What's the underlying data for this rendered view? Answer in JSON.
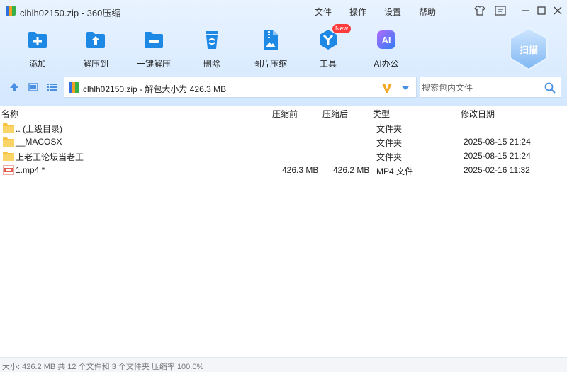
{
  "window": {
    "title": "clhlh02150.zip - 360压缩",
    "menus": [
      "文件",
      "操作",
      "设置",
      "帮助"
    ]
  },
  "toolbar": {
    "items": [
      {
        "label": "添加",
        "icon": "add-icon"
      },
      {
        "label": "解压到",
        "icon": "extract-to-icon"
      },
      {
        "label": "一键解压",
        "icon": "one-click-extract-icon"
      },
      {
        "label": "删除",
        "icon": "delete-icon"
      },
      {
        "label": "图片压缩",
        "icon": "image-compress-icon"
      },
      {
        "label": "工具",
        "icon": "tools-icon",
        "badge": "New"
      },
      {
        "label": "AI办公",
        "icon": "ai-office-icon",
        "icon_text": "AI"
      }
    ],
    "scan_label": "扫描"
  },
  "address": {
    "text": "clhlh02150.zip - 解包大小为 426.3 MB"
  },
  "search": {
    "placeholder": "搜索包内文件"
  },
  "columns": {
    "name": "名称",
    "compressed_before": "压缩前",
    "compressed_after": "压缩后",
    "type": "类型",
    "modified": "修改日期"
  },
  "files": [
    {
      "name": ".. (上级目录)",
      "before": "",
      "after": "",
      "type": "文件夹",
      "modified": "",
      "icon": "folder-icon"
    },
    {
      "name": "__MACOSX",
      "before": "",
      "after": "",
      "type": "文件夹",
      "modified": "2025-08-15 21:24",
      "icon": "folder-icon"
    },
    {
      "name": "上老王论坛当老王",
      "before": "",
      "after": "",
      "type": "文件夹",
      "modified": "2025-08-15 21:24",
      "icon": "folder-icon"
    },
    {
      "name": "1.mp4 *",
      "before": "426.3 MB",
      "after": "426.2 MB",
      "type": "MP4 文件",
      "modified": "2025-02-16 11:32",
      "icon": "mp4-file-icon"
    }
  ],
  "status": {
    "text": "大小: 426.2 MB 共 12 个文件和 3 个文件夹 压缩率 100.0%"
  },
  "colors": {
    "accent": "#1e88e5",
    "folder": "#f6c344",
    "header_bg": "#dcecff"
  }
}
